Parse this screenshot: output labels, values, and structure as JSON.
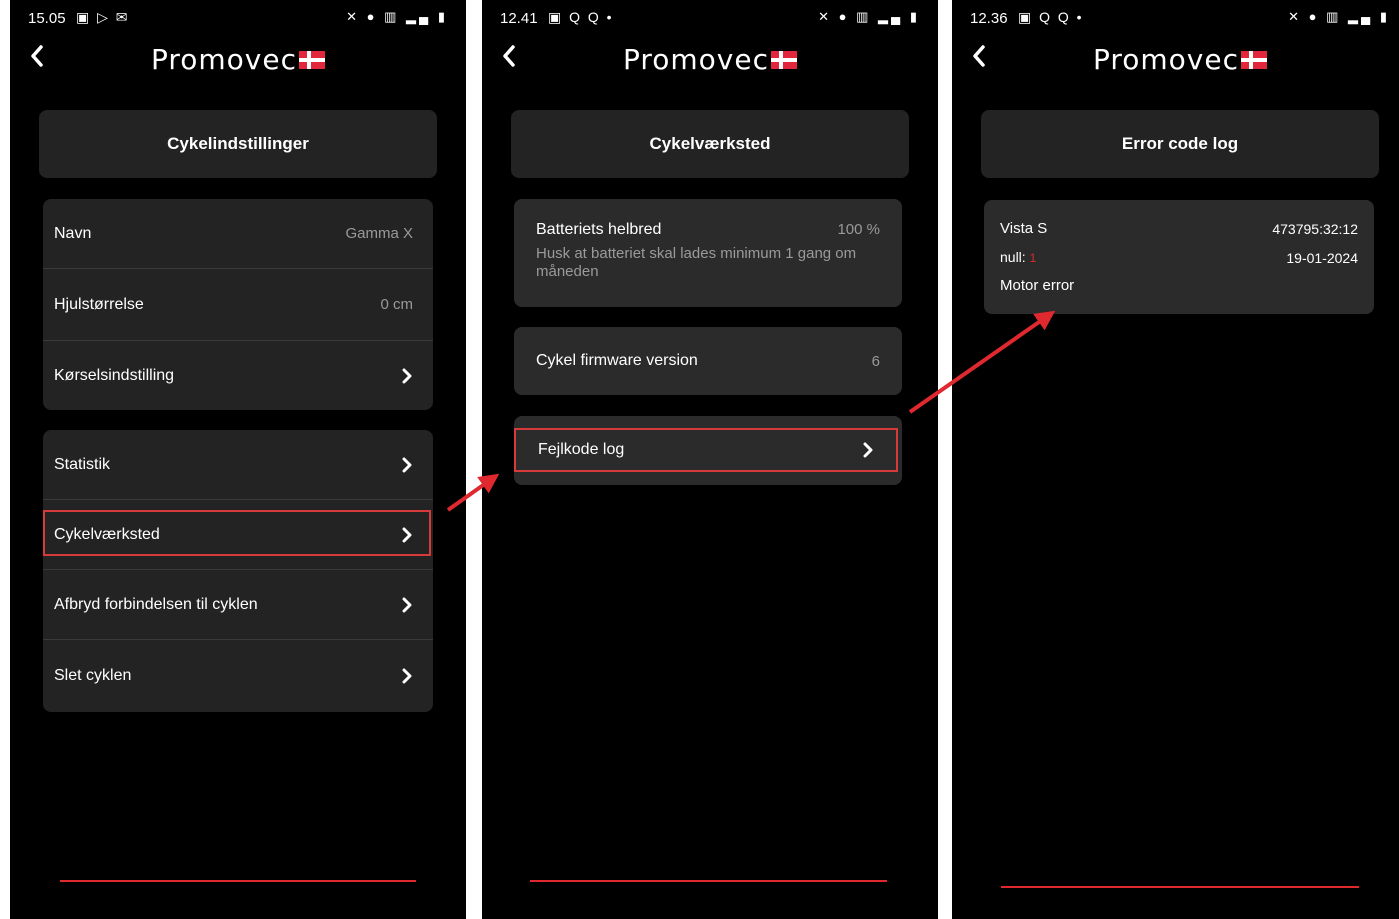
{
  "logo": {
    "text": "Promovec"
  },
  "phones": [
    {
      "status": {
        "time": "15.05",
        "icons_left": "▣ ▷ ✉",
        "icons_right": "✕ ● ▥ ▂▄ ▮"
      },
      "title": "Cykelindstillinger",
      "group1": [
        {
          "label": "Navn",
          "value": "Gamma X"
        },
        {
          "label": "Hjulstørrelse",
          "value": "0 cm"
        },
        {
          "label": "Kørselsindstilling"
        }
      ],
      "group2": [
        {
          "label": "Statistik"
        },
        {
          "label": "Cykelværksted"
        },
        {
          "label": "Afbryd forbindelsen til cyklen"
        },
        {
          "label": "Slet cyklen"
        }
      ]
    },
    {
      "status": {
        "time": "12.41",
        "icons_left": "▣ Q Q •",
        "icons_right": "✕ ● ▥ ▂▄ ▮"
      },
      "title": "Cykelværksted",
      "battery": {
        "label": "Batteriets helbred",
        "value": "100 %",
        "note": "Husk at batteriet skal lades minimum 1 gang om måneden"
      },
      "firmware": {
        "label": "Cykel firmware version",
        "value": "6"
      },
      "log": {
        "label": "Fejlkode log"
      }
    },
    {
      "status": {
        "time": "12.36",
        "icons_left": "▣ Q Q •",
        "icons_right": "✕ ● ▥ ▂▄ ▮"
      },
      "title": "Error code log",
      "entry": {
        "bike": "Vista S",
        "code": "473795:32:12",
        "null_label": "null:",
        "null_value": "1",
        "date": "19-01-2024",
        "message": "Motor error"
      }
    }
  ],
  "colors": {
    "accent_red": "#e0282f",
    "card": "#232323",
    "background": "#000000"
  },
  "icons": {
    "back": "chevron-left-icon",
    "row": "chevron-right-icon",
    "flag": "danish-flag-icon"
  }
}
